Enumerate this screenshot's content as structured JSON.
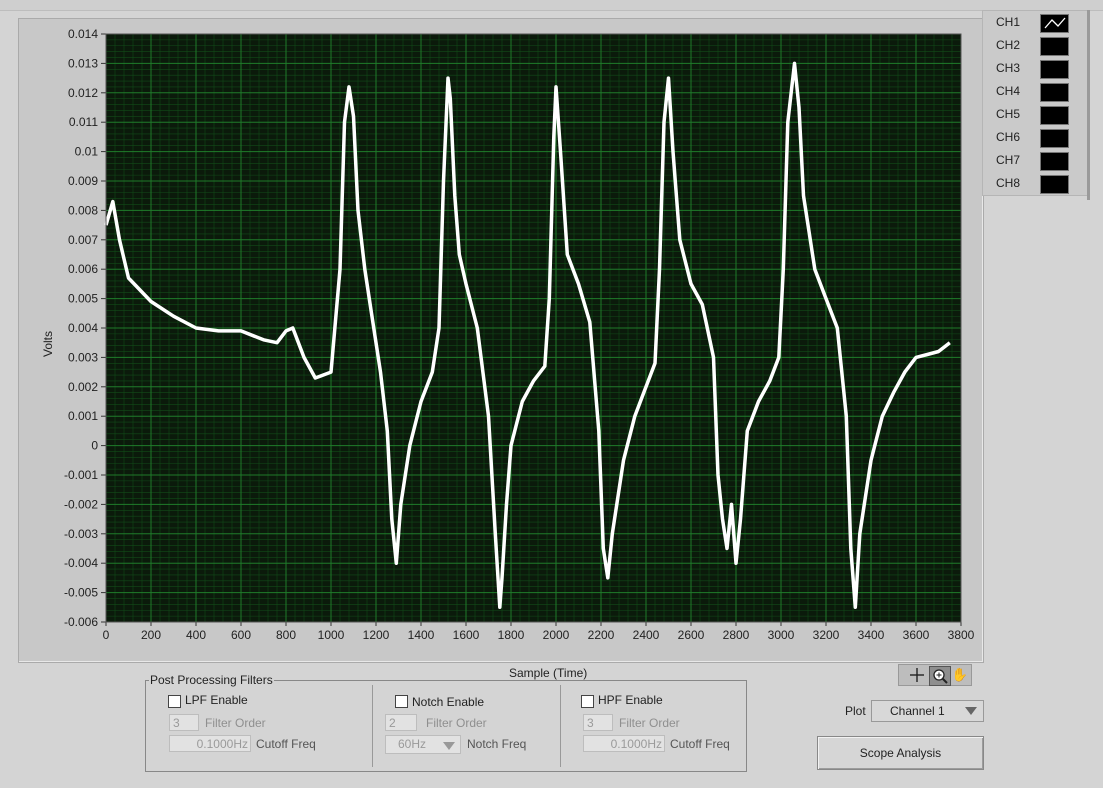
{
  "graph": {
    "ylabel": "Volts",
    "xlabel": "Sample (Time)",
    "colors": {
      "plot_bg": "#0b1a0b",
      "grid": "#1f7a2a",
      "grid_minor": "#124a18",
      "trace": "#ffffff"
    }
  },
  "chart_data": {
    "type": "line",
    "xlabel": "Sample (Time)",
    "ylabel": "Volts",
    "xlim": [
      0,
      3800
    ],
    "ylim": [
      -0.006,
      0.014
    ],
    "xticks": [
      "0",
      "200",
      "400",
      "600",
      "800",
      "1000",
      "1200",
      "1400",
      "1600",
      "1800",
      "2000",
      "2200",
      "2400",
      "2600",
      "2800",
      "3000",
      "3200",
      "3400",
      "3600",
      "3800"
    ],
    "yticks": [
      "0.014",
      "0.013",
      "0.012",
      "0.011",
      "0.01",
      "0.009",
      "0.008",
      "0.007",
      "0.006",
      "0.005",
      "0.004",
      "0.003",
      "0.002",
      "0.001",
      "0",
      "-0.001",
      "-0.002",
      "-0.003",
      "-0.004",
      "-0.005",
      "-0.006"
    ],
    "grid": true,
    "series": [
      {
        "color": "#ffffff",
        "x": [
          0,
          30,
          60,
          100,
          200,
          300,
          400,
          500,
          600,
          700,
          760,
          800,
          830,
          880,
          930,
          1000,
          1040,
          1060,
          1080,
          1100,
          1120,
          1150,
          1180,
          1220,
          1250,
          1270,
          1290,
          1310,
          1350,
          1400,
          1450,
          1480,
          1500,
          1520,
          1530,
          1550,
          1570,
          1600,
          1650,
          1700,
          1730,
          1750,
          1760,
          1780,
          1800,
          1850,
          1900,
          1950,
          1970,
          1990,
          2000,
          2020,
          2050,
          2100,
          2150,
          2190,
          2210,
          2230,
          2250,
          2300,
          2350,
          2400,
          2440,
          2460,
          2480,
          2500,
          2520,
          2550,
          2600,
          2650,
          2700,
          2720,
          2740,
          2760,
          2780,
          2800,
          2820,
          2850,
          2900,
          2950,
          2990,
          3010,
          3030,
          3060,
          3080,
          3100,
          3150,
          3200,
          3250,
          3290,
          3310,
          3330,
          3350,
          3400,
          3450,
          3500,
          3550,
          3600,
          3650,
          3700,
          3750
        ],
        "y": [
          0.0075,
          0.0083,
          0.007,
          0.0057,
          0.0049,
          0.0044,
          0.004,
          0.0039,
          0.0039,
          0.0036,
          0.0035,
          0.0039,
          0.004,
          0.003,
          0.0023,
          0.0025,
          0.006,
          0.011,
          0.0122,
          0.0112,
          0.008,
          0.006,
          0.0045,
          0.0025,
          0.0005,
          -0.0025,
          -0.004,
          -0.002,
          0.0,
          0.0015,
          0.0025,
          0.004,
          0.009,
          0.0125,
          0.0118,
          0.0085,
          0.0065,
          0.0055,
          0.004,
          0.001,
          -0.003,
          -0.0055,
          -0.0045,
          -0.002,
          0.0,
          0.0015,
          0.0022,
          0.0027,
          0.005,
          0.0105,
          0.0122,
          0.01,
          0.0065,
          0.0055,
          0.0042,
          0.0005,
          -0.0035,
          -0.0045,
          -0.003,
          -0.0005,
          0.001,
          0.002,
          0.0028,
          0.006,
          0.011,
          0.0125,
          0.01,
          0.007,
          0.0055,
          0.0048,
          0.003,
          -0.001,
          -0.0025,
          -0.0035,
          -0.002,
          -0.004,
          -0.0025,
          0.0005,
          0.0015,
          0.0022,
          0.003,
          0.006,
          0.011,
          0.013,
          0.0115,
          0.0085,
          0.006,
          0.005,
          0.004,
          0.001,
          -0.0035,
          -0.0055,
          -0.003,
          -0.0005,
          0.001,
          0.0018,
          0.0025,
          0.003,
          0.0031,
          0.0032,
          0.0035
        ]
      }
    ]
  },
  "legend": {
    "items": [
      {
        "label": "CH1",
        "has_trace": true
      },
      {
        "label": "CH2",
        "has_trace": false
      },
      {
        "label": "CH3",
        "has_trace": false
      },
      {
        "label": "CH4",
        "has_trace": false
      },
      {
        "label": "CH5",
        "has_trace": false
      },
      {
        "label": "CH6",
        "has_trace": false
      },
      {
        "label": "CH7",
        "has_trace": false
      },
      {
        "label": "CH8",
        "has_trace": false
      }
    ]
  },
  "tools": {
    "cursor_icon": "crosshair-icon",
    "zoom_icon": "zoom-icon",
    "pan_icon": "hand-icon"
  },
  "filters": {
    "title": "Post Processing Filters",
    "lpf": {
      "enable_label": "LPF Enable",
      "order_value": "3",
      "order_label": "Filter Order",
      "cutoff_value": "0.1000Hz",
      "cutoff_label": "Cutoff Freq"
    },
    "notch": {
      "enable_label": "Notch Enable",
      "order_value": "2",
      "order_label": "Filter Order",
      "freq_value": "60Hz",
      "freq_label": "Notch Freq"
    },
    "hpf": {
      "enable_label": "HPF Enable",
      "order_value": "3",
      "order_label": "Filter Order",
      "cutoff_value": "0.1000Hz",
      "cutoff_label": "Cutoff Freq"
    }
  },
  "plot_select": {
    "label": "Plot",
    "value": "Channel 1"
  },
  "scope_button": {
    "label": "Scope Analysis"
  }
}
